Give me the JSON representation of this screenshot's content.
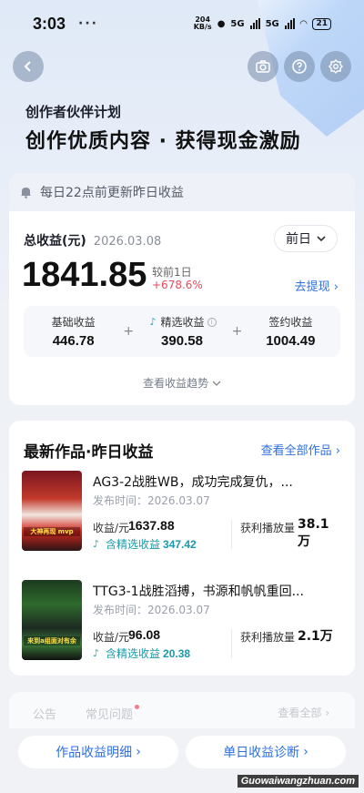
{
  "status_bar": {
    "time": "3:03",
    "dots": "···",
    "speed_top": "204",
    "speed_unit": "KB/s",
    "network_1": "5G",
    "network_2": "5G",
    "battery": "21"
  },
  "header": {
    "subtitle": "创作者伙伴计划",
    "title": "创作优质内容 · 获得现金激励"
  },
  "earnings": {
    "notice": "每日22点前更新昨日收益",
    "total_label": "总收益(元)",
    "date": "2026.03.08",
    "period_select": "前日",
    "total_value": "1841.85",
    "compare_label": "较前1日",
    "compare_value": "+678.6%",
    "withdraw_link": "去提现",
    "breakdown": [
      {
        "label": "基础收益",
        "value": "446.78"
      },
      {
        "label": "精选收益",
        "value": "390.58"
      },
      {
        "label": "签约收益",
        "value": "1004.49"
      }
    ],
    "trend_link": "查看收益趋势"
  },
  "works": {
    "title": "最新作品·昨日收益",
    "view_all": "查看全部作品",
    "items": [
      {
        "title": "AG3-2战胜WB，成功完成复仇，...",
        "date": "发布时间：2026.03.07",
        "earn_label": "收益/元",
        "earn_value": "1637.88",
        "pick_label": "含精选收益",
        "pick_value": "347.42",
        "play_label": "获利播放量",
        "play_value": "38.1万",
        "thumb_text": "大神再现 mvp"
      },
      {
        "title": "TTG3-1战胜滔搏，书源和帆帆重回...",
        "date": "发布时间：2026.03.07",
        "earn_label": "收益/元",
        "earn_value": "96.08",
        "pick_label": "含精选收益",
        "pick_value": "20.38",
        "play_label": "获利播放量",
        "play_value": "2.1万",
        "thumb_text": "来到a组面对有余"
      }
    ]
  },
  "notice_tabs": {
    "tab_a": "公告",
    "tab_b": "常见问题",
    "more": "查看全部"
  },
  "bottom_buttons": {
    "detail": "作品收益明细",
    "diagnose": "单日收益诊断"
  },
  "watermark": "Guowaiwangzhuan.com",
  "colors": {
    "accent_blue": "#2f6fe0",
    "increase_red": "#e84a5f",
    "pick_teal": "#1a9aa8"
  }
}
